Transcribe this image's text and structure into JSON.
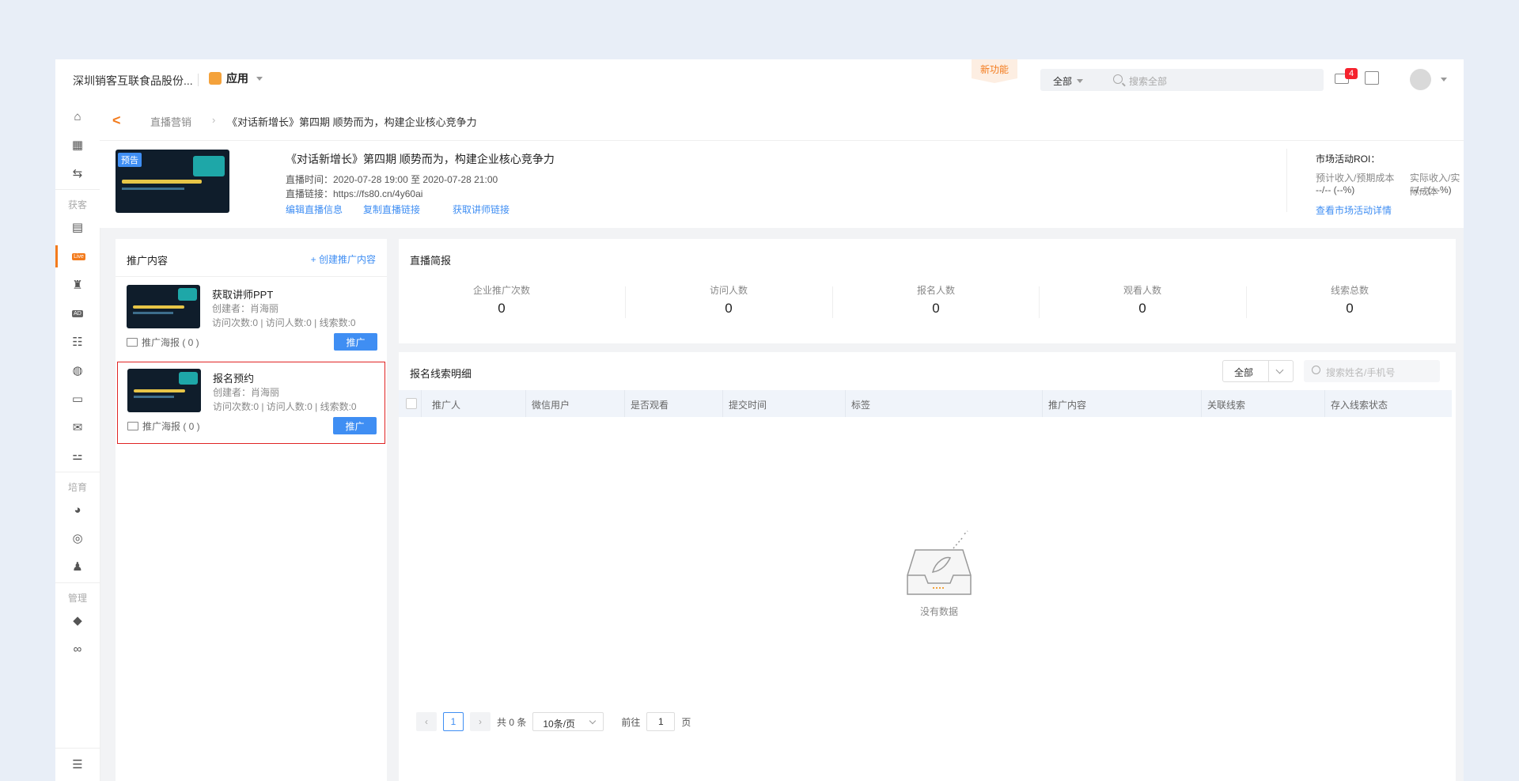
{
  "topbar": {
    "company": "深圳销客互联食品股份...",
    "app_label": "应用",
    "new_feature": "新功能",
    "search_scope": "全部",
    "search_placeholder": "搜索全部",
    "mail_badge": "4"
  },
  "sidebar": {
    "section_acquire": "获客",
    "section_nurture": "培育",
    "section_manage": "管理",
    "live_tag": "Live",
    "ad_tag": "AD"
  },
  "breadcrumb": {
    "parent": "直播营销",
    "current": "《对话新增长》第四期 顺势而为，构建企业核心竞争力"
  },
  "info": {
    "thumb_tag": "预告",
    "title": "《对话新增长》第四期 顺势而为，构建企业核心竞争力",
    "time_line": "直播时间：2020-07-28 19:00 至 2020-07-28 21:00",
    "link_line": "直播链接：https://fs80.cn/4y60ai",
    "actions": {
      "edit": "编辑直播信息",
      "copy": "复制直播链接",
      "lecturer": "获取讲师链接"
    },
    "roi": {
      "title": "市场活动ROI：",
      "estimated_label": "预计收入/预期成本",
      "actual_label": "实际收入/实际成本",
      "estimated_value": "--/-- (--%)",
      "actual_value": "--/-- ( --%)",
      "detail_link": "查看市场活动详情"
    }
  },
  "promo": {
    "title": "推广内容",
    "create": "+ 创建推广内容",
    "cards": [
      {
        "title": "获取讲师PPT",
        "creator": "创建者：肖海丽",
        "stats": "访问次数:0 | 访问人数:0 | 线索数:0",
        "poster": "推广海报 ( 0 )",
        "button": "推广"
      },
      {
        "title": "报名预约",
        "creator": "创建者：肖海丽",
        "stats": "访问次数:0 | 访问人数:0 | 线索数:0",
        "poster": "推广海报 ( 0 )",
        "button": "推广"
      }
    ]
  },
  "summary": {
    "title": "直播简报",
    "stats": [
      {
        "label": "企业推广次数",
        "value": "0"
      },
      {
        "label": "访问人数",
        "value": "0"
      },
      {
        "label": "报名人数",
        "value": "0"
      },
      {
        "label": "观看人数",
        "value": "0"
      },
      {
        "label": "线索总数",
        "value": "0"
      }
    ]
  },
  "leads": {
    "title": "报名线索明细",
    "filter": "全部",
    "search_placeholder": "搜索姓名/手机号",
    "columns": [
      "推广人",
      "微信用户",
      "是否观看",
      "提交时间",
      "标签",
      "推广内容",
      "关联线索",
      "存入线索状态"
    ],
    "empty_text": "没有数据",
    "pager": {
      "current": "1",
      "total": "共 0 条",
      "page_size": "10条/页",
      "goto_prefix": "前往",
      "goto_value": "1",
      "goto_suffix": "页"
    }
  },
  "colors": {
    "accent": "#f37b1d",
    "primary": "#3f8ef3",
    "selected_border": "#e02424"
  }
}
